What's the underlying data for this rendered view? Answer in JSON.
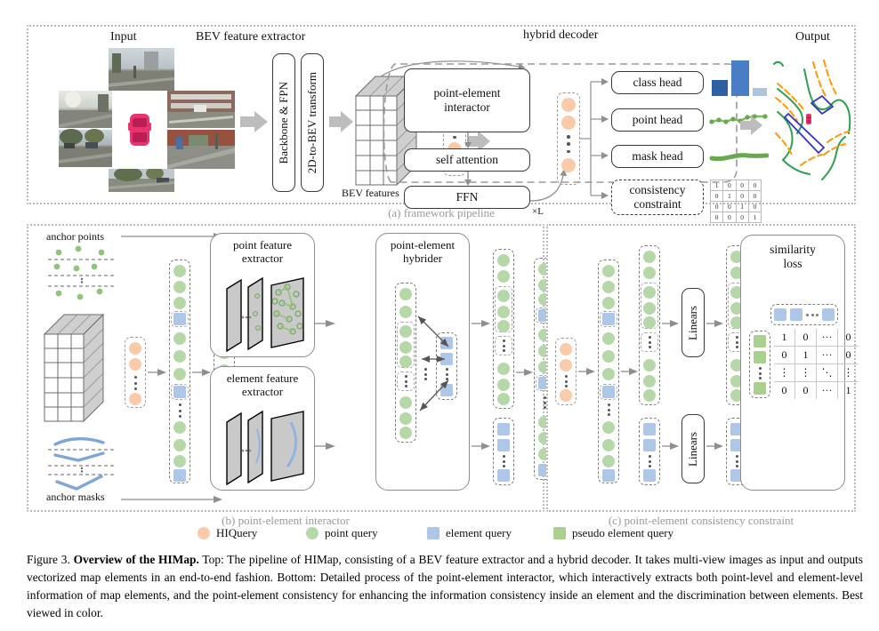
{
  "figure": {
    "number": "Figure 3.",
    "title": "Overview of the HIMap.",
    "body": " Top: The pipeline of HIMap, consisting of a BEV feature extractor and a hybrid decoder. It takes multi-view images as input and outputs vectorized map elements in an end-to-end fashion. Bottom: Detailed process of the point-element interactor, which interactively extracts both point-level and element-level information of map elements, and the point-element consistency for enhancing the information consistency inside an element and the discrimination between elements. Best viewed in color."
  },
  "panel_a": {
    "caption": "(a) framework pipeline",
    "input_title": "Input",
    "bev_extractor_title": "BEV feature extractor",
    "backbone_label": "Backbone & FPN",
    "transform_label": "2D-to-BEV transform",
    "bev_features_label": "BEV features",
    "decoder_title": "hybrid decoder",
    "interactor_label": "point-element\ninteractor",
    "interactor_line1": "point-element",
    "interactor_line2": "interactor",
    "self_attention_label": "self attention",
    "ffn_label": "FFN",
    "loop_label": "×L",
    "class_head_label": "class head",
    "point_head_label": "point head",
    "mask_head_label": "mask head",
    "consistency_line1": "consistency",
    "consistency_line2": "constraint",
    "output_title": "Output",
    "class_head_bars": [
      {
        "height": 18,
        "color": "#2e5fa3"
      },
      {
        "height": 40,
        "color": "#4a7ec4"
      },
      {
        "height": 9,
        "color": "#aec3e0"
      }
    ],
    "consistency_matrix": [
      [
        "1",
        "0",
        "0",
        "0"
      ],
      [
        "0",
        "1",
        "0",
        "0"
      ],
      [
        "0",
        "0",
        "1",
        "0"
      ],
      [
        "0",
        "0",
        "0",
        "1"
      ]
    ]
  },
  "panel_b": {
    "caption": "(b) point-element interactor",
    "anchor_points_label": "anchor points",
    "anchor_masks_label": "anchor masks",
    "point_feature_line1": "point feature",
    "point_feature_line2": "extractor",
    "element_feature_line1": "element feature",
    "element_feature_line2": "extractor",
    "hybrider_line1": "point-element",
    "hybrider_line2": "hybrider"
  },
  "panel_c": {
    "caption": "(c) point-element consistency constraint",
    "linears_label": "Linears",
    "similarity_line1": "similarity",
    "similarity_line2": "loss",
    "similarity_matrix": [
      [
        "1",
        "0",
        "···",
        "0"
      ],
      [
        "0",
        "1",
        "···",
        "0"
      ],
      [
        "⋮",
        "⋮",
        "⋱",
        "⋮"
      ],
      [
        "0",
        "0",
        "···",
        "1"
      ]
    ]
  },
  "legend": {
    "items": [
      {
        "label": "HIQuery",
        "shape": "circle",
        "color": "#f9cbab"
      },
      {
        "label": "point query",
        "shape": "circle",
        "color": "#b6d7a8"
      },
      {
        "label": "element query",
        "shape": "square",
        "color": "#aec6e8"
      },
      {
        "label": "pseudo element query",
        "shape": "square",
        "color": "#a9d08e"
      }
    ]
  },
  "colors": {
    "hiquery": "#f9cbab",
    "point_query": "#b6d7a8",
    "element_query": "#aec6e8",
    "pseudo_element_query": "#a9d08e",
    "arrow_gray": "#9a9a9a",
    "map_divider": "#ff9900",
    "map_boundary": "#2e9e4f",
    "map_pedestrian": "#3333cc",
    "ego_car": "#e8336d"
  }
}
